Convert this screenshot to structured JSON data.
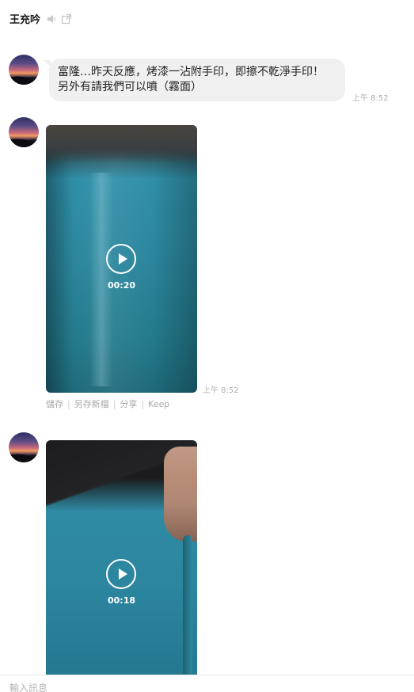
{
  "header": {
    "name": "王充吟",
    "icons": [
      "speaker-icon",
      "popout-icon"
    ]
  },
  "messages": [
    {
      "type": "text",
      "lines": [
        "富隆…昨天反應，烤漆一沾附手印，即擦不乾淨手印！",
        "另外有請我們可以噴（霧面）"
      ],
      "time": "上午 8:52"
    },
    {
      "type": "video",
      "duration": "00:20",
      "time": "上午 8:52",
      "actions": [
        "儲存",
        "另存新檔",
        "分享",
        "Keep"
      ]
    },
    {
      "type": "video",
      "duration": "00:18"
    }
  ],
  "input": {
    "placeholder": "輸入訊息"
  }
}
